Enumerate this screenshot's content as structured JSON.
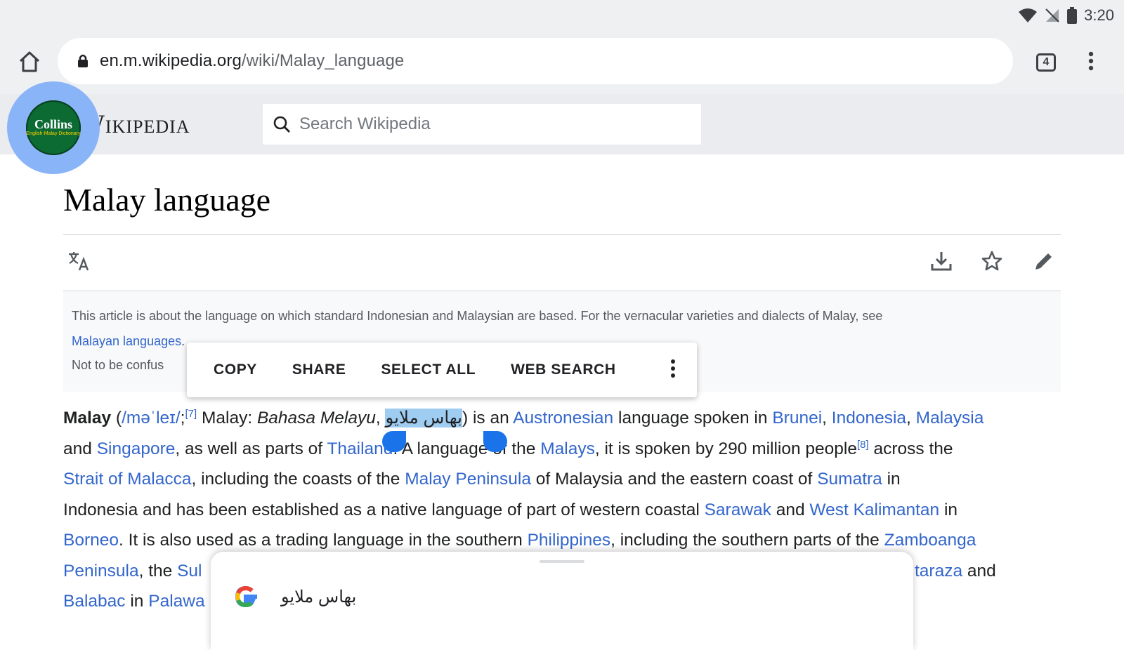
{
  "status_bar": {
    "time": "3:20"
  },
  "browser": {
    "url_host": "en.m.wikipedia.org",
    "url_path": "/wiki/Malay_language",
    "tab_count": "4"
  },
  "wiki": {
    "wordmark": "Wikipedia",
    "search_placeholder": "Search Wikipedia"
  },
  "overlay_app": {
    "name": "Collins",
    "subtitle": "English-Malay Dictionary"
  },
  "article": {
    "title": "Malay language",
    "hatnote_text": "This article is about the language on which standard Indonesian and Malaysian are based. For the vernacular varieties and dialects of Malay, see",
    "hatnote_link": "Malayan languages",
    "hatnote_end": ".",
    "hatnote2": "Not to be confus",
    "paragraph": {
      "l1_bold": "Malay",
      "l1_a": " (",
      "l1_ipa": "/məˈleɪ/",
      "l1_b": ";",
      "ref7": "[7]",
      "l1_c": " Malay: ",
      "l1_italic": "Bahasa Melayu",
      "l1_d": ", ",
      "l1_selected": "بهاس ملايو",
      "l1_e": ") is an ",
      "l1_link1": "Austronesian",
      "l1_f": " language spoken in ",
      "l1_link2": "Brunei",
      "l1_g": ", ",
      "l1_link3": "Indonesia",
      "l1_h": ", ",
      "l1_link4": "Malaysia",
      "l2_a": "and ",
      "l2_link1": "Singapore",
      "l2_b": ", as well as parts of ",
      "l2_link2": "Thailand",
      "l2_c": ". A language of the ",
      "l2_link3": "Malays",
      "l2_d": ", it is spoken by 290 million people",
      "ref8": "[8]",
      "l2_e": " across the",
      "l3_link1": "Strait of Malacca",
      "l3_a": ", including the coasts of the ",
      "l3_link2": "Malay Peninsula",
      "l3_b": " of Malaysia and the eastern coast of ",
      "l3_link3": "Sumatra",
      "l3_c": " in",
      "l4_a": "Indonesia and has been established as a native language of part of western coastal ",
      "l4_link1": "Sarawak",
      "l4_b": " and ",
      "l4_link2": "West Kalimantan",
      "l4_c": " in",
      "l5_link1": "Borneo",
      "l5_a": ". It is also used as a trading language in the southern ",
      "l5_link2": "Philippines",
      "l5_b": ", including the southern parts of the ",
      "l5_link3": "Zamboanga",
      "l6_link1": "Peninsula",
      "l6_a": ", the ",
      "l6_link2": "Sul",
      "l6_link3": "taraza",
      "l6_b": " and",
      "l7_link1": "Balabac",
      "l7_a": " in ",
      "l7_link2": "Palawa"
    }
  },
  "context_menu": {
    "copy": "COPY",
    "share": "SHARE",
    "select_all": "SELECT ALL",
    "web_search": "WEB SEARCH"
  },
  "search_sheet": {
    "query": "بهاس ملايو"
  },
  "colors": {
    "link": "#3366cc",
    "selection": "#9fcdf2",
    "handle": "#1a73e8",
    "overlay_bubble": "#8ab4f8"
  }
}
